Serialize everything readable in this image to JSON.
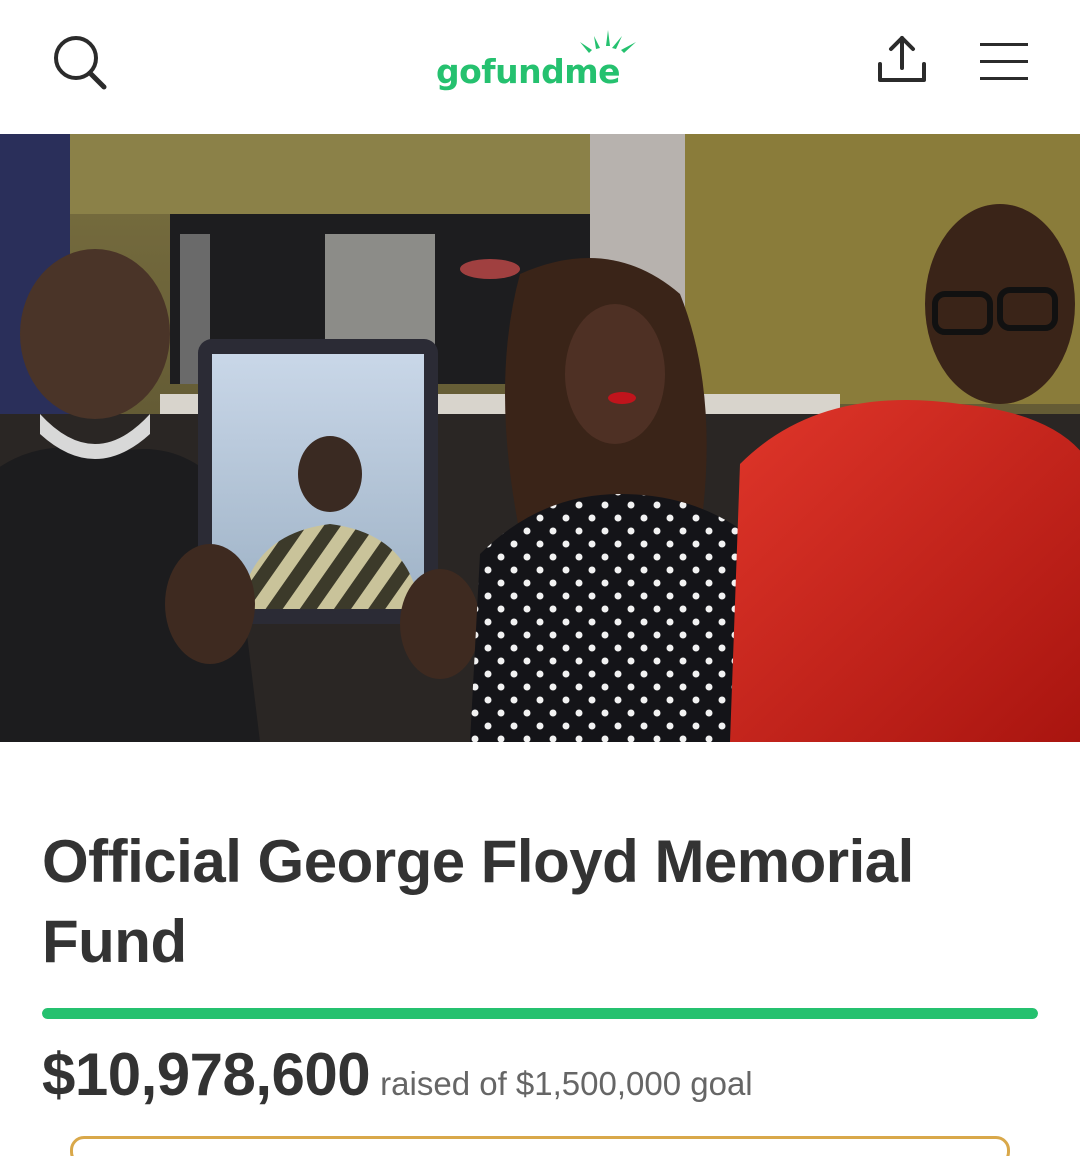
{
  "colors": {
    "brand_green": "#25c16f",
    "text_dark": "#333333",
    "text_muted": "#666666",
    "progress_fill": "#25c16f",
    "button_edge": "#d9a84a"
  },
  "header": {
    "search_icon": "search-icon",
    "logo": {
      "text": "gofundme"
    },
    "share_icon": "share-icon",
    "menu_icon": "hamburger-menu-icon"
  },
  "hero": {
    "description_icon": "campaign-photo"
  },
  "campaign": {
    "title": "Official George Floyd Memorial Fund",
    "amount_raised": "$10,978,600",
    "raised_text": "raised of $1,500,000 goal",
    "progress_fraction": 1.0
  }
}
